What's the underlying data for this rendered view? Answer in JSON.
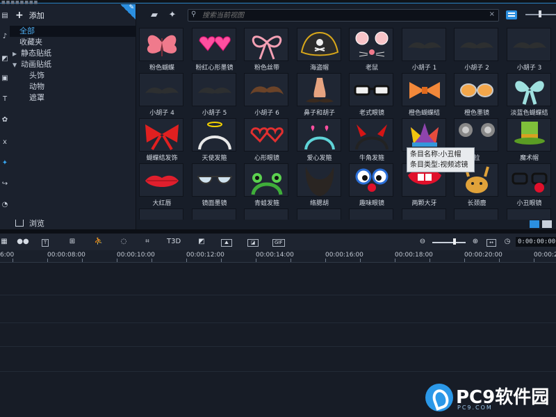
{
  "categories": {
    "add_label": "添加",
    "items": [
      {
        "label": "全部",
        "selected": true
      },
      {
        "label": "收藏夹"
      },
      {
        "label": "静态贴纸",
        "expandable": true
      },
      {
        "label": "动画贴纸",
        "expandable": true,
        "expanded": true
      },
      {
        "label": "头饰",
        "child": true
      },
      {
        "label": "动物",
        "child": true
      },
      {
        "label": "遮罩",
        "child": true
      }
    ],
    "browse_label": "浏览"
  },
  "library": {
    "search_placeholder": "搜索当前视图",
    "tiles": [
      {
        "label": "粉色蝴蝶",
        "icon": "pink-butterfly"
      },
      {
        "label": "粉红心形墨镜",
        "icon": "heart-glasses"
      },
      {
        "label": "粉色丝带",
        "icon": "pink-ribbon"
      },
      {
        "label": "海盗帽",
        "icon": "pirate-hat"
      },
      {
        "label": "老鼠",
        "icon": "mouse-face"
      },
      {
        "label": "小胡子 1",
        "icon": "mustache"
      },
      {
        "label": "小胡子 2",
        "icon": "mustache"
      },
      {
        "label": "小胡子 3",
        "icon": "mustache"
      },
      {
        "label": "小胡子 4",
        "icon": "mustache"
      },
      {
        "label": "小胡子 5",
        "icon": "mustache"
      },
      {
        "label": "小胡子 6",
        "icon": "mustache-brown"
      },
      {
        "label": "鼻子和胡子",
        "icon": "nose-mustache"
      },
      {
        "label": "老式眼镜",
        "icon": "old-glasses"
      },
      {
        "label": "橙色蝴蝶结",
        "icon": "orange-bow"
      },
      {
        "label": "橙色墨镜",
        "icon": "orange-sunglasses"
      },
      {
        "label": "淡蓝色蝴蝶结",
        "icon": "blue-bow"
      },
      {
        "label": "蝴蝶结发饰",
        "icon": "red-bow"
      },
      {
        "label": "天使发箍",
        "icon": "angel-headband"
      },
      {
        "label": "心形眼镜",
        "icon": "heart-frames"
      },
      {
        "label": "爱心发箍",
        "icon": "heart-headband"
      },
      {
        "label": "牛角发箍",
        "icon": "horn-headband"
      },
      {
        "label": "",
        "icon": "jester-hat"
      },
      {
        "label": "拉",
        "icon": "grey-ears"
      },
      {
        "label": "魔术帽",
        "icon": "green-top-hat"
      },
      {
        "label": "大红唇",
        "icon": "red-lips"
      },
      {
        "label": "镜面墨镜",
        "icon": "mirror-sunglasses"
      },
      {
        "label": "青蛙发箍",
        "icon": "frog-headband"
      },
      {
        "label": "络腮胡",
        "icon": "full-beard"
      },
      {
        "label": "趣味眼镜",
        "icon": "funny-glasses"
      },
      {
        "label": "两颗大牙",
        "icon": "big-teeth"
      },
      {
        "label": "长颈鹿",
        "icon": "giraffe"
      },
      {
        "label": "小丑眼镜",
        "icon": "clown-glasses"
      }
    ],
    "tooltip": {
      "name_line": "条目名称:小丑帽",
      "type_line": "条目类型:视频滤镜"
    }
  },
  "timeline": {
    "time_display": "0:00:00:00",
    "ruler_labels": [
      "6:00",
      "00:00:08:00",
      "00:00:10:00",
      "00:00:12:00",
      "00:00:14:00",
      "00:00:16:00",
      "00:00:18:00",
      "00:00:20:00",
      "00:00:2"
    ],
    "tool_labels": {
      "title": "T",
      "3d_title": "T3D",
      "gif": "GIF"
    }
  },
  "watermark": {
    "brand": "PC9软件园",
    "url": "PC9.COM"
  }
}
